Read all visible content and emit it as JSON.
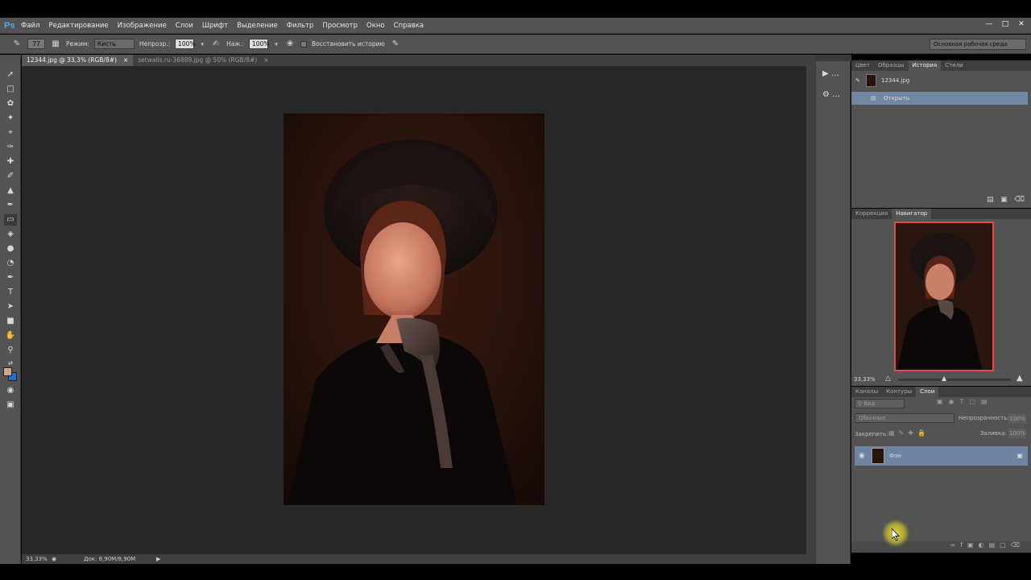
{
  "app": {
    "logo": "Ps"
  },
  "menu": [
    "Файл",
    "Редактирование",
    "Изображение",
    "Слои",
    "Шрифт",
    "Выделение",
    "Фильтр",
    "Просмотр",
    "Окно",
    "Справка"
  ],
  "options": {
    "brush_size": "77",
    "mode_label": "Режим:",
    "mode_value": "Кисть",
    "opacity_label": "Непрозр.:",
    "opacity_value": "100%",
    "pressure_label": "Наж.:",
    "pressure_value": "100%",
    "restore_history_label": "Восстановить историю",
    "workspace": "Основная рабочая среда"
  },
  "tabs": [
    {
      "label": "12344.jpg @ 33,3% (RGB/8#)",
      "active": true,
      "close": "×"
    },
    {
      "label": "setwalls.ru-36889.jpg @ 50% (RGB/8#)",
      "active": false,
      "close": "×"
    }
  ],
  "status": {
    "zoom": "33,33%",
    "doc": "Док: 8,90M/8,90M"
  },
  "history_panel": {
    "tabs": [
      "Цвет",
      "Образцы",
      "История",
      "Стили"
    ],
    "active_tab": "История",
    "snapshot": "12344.jpg",
    "steps": [
      "Открыть"
    ]
  },
  "navigator_panel": {
    "tabs": [
      "Коррекция",
      "Навигатор"
    ],
    "active_tab": "Навигатор",
    "zoom": "33,33%"
  },
  "layers_panel": {
    "tabs": [
      "Каналы",
      "Контуры",
      "Слои"
    ],
    "active_tab": "Слои",
    "filter": "Вид",
    "blend_mode": "Обычные",
    "opacity_label": "Непрозрачность:",
    "opacity_value": "100%",
    "lock_label": "Закрепить:",
    "fill_label": "Заливка:",
    "fill_value": "100%",
    "layers": [
      {
        "name": "Фон"
      }
    ]
  },
  "colors": {
    "foreground": "#c7a98d",
    "background": "#1f6fd6",
    "selection_highlight": "#7187a5",
    "ps_logo": "#4fa9e8"
  }
}
